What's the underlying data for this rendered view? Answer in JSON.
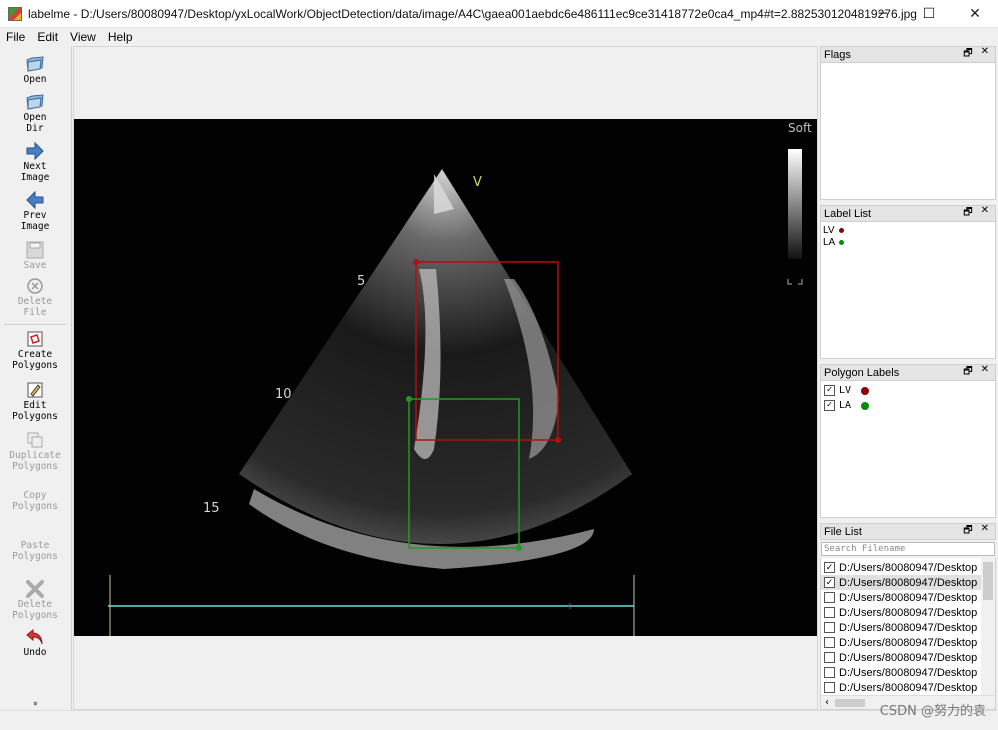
{
  "window": {
    "title": "labelme - D:/Users/80080947/Desktop/yxLocalWork/ObjectDetection/data/image/A4C\\gaea001aebdc6e486111ec9ce31418772e0ca4_mp4#t=2.8825301204819276.jpg",
    "minimize": "─",
    "maximize": "☐",
    "close": "✕"
  },
  "menu": [
    "File",
    "Edit",
    "View",
    "Help"
  ],
  "toolbar": {
    "open": "Open",
    "open_dir": "Open\nDir",
    "next_image": "Next\nImage",
    "prev_image": "Prev\nImage",
    "save": "Save",
    "delete_file": "Delete\nFile",
    "create_polygons": "Create\nPolygons",
    "edit_polygons": "Edit\nPolygons",
    "duplicate_polygons": "Duplicate\nPolygons",
    "copy_polygons": "Copy\nPolygons",
    "paste_polygons": "Paste\nPolygons",
    "delete_polygons": "Delete\nPolygons",
    "undo": "Undo",
    "more": "»"
  },
  "image": {
    "soft_label": "Soft",
    "v_label": "V",
    "depth_5": "5",
    "depth_10": "10",
    "depth_15": "15",
    "depth_marks": [
      "5",
      "10",
      "15"
    ]
  },
  "annotations": [
    {
      "label": "LV",
      "color": "#b01010"
    },
    {
      "label": "LA",
      "color": "#1f9a1f"
    }
  ],
  "docks": {
    "flags": {
      "title": "Flags",
      "float_icon": "🗗",
      "close_icon": "✕"
    },
    "label_list": {
      "title": "Label List",
      "items": [
        {
          "label": "LV",
          "color": "#8b0000"
        },
        {
          "label": "LA",
          "color": "#0a8a0a"
        }
      ]
    },
    "polygon_labels": {
      "title": "Polygon Labels",
      "items": [
        {
          "label": "LV",
          "color": "#8b0000",
          "checked": true
        },
        {
          "label": "LA",
          "color": "#0a8a0a",
          "checked": true
        }
      ]
    },
    "file_list": {
      "title": "File List",
      "search_placeholder": "Search Filename",
      "files": [
        {
          "name": "D:/Users/80080947/Desktop",
          "checked": true
        },
        {
          "name": "D:/Users/80080947/Desktop",
          "checked": true,
          "selected": true
        },
        {
          "name": "D:/Users/80080947/Desktop",
          "checked": false
        },
        {
          "name": "D:/Users/80080947/Desktop",
          "checked": false
        },
        {
          "name": "D:/Users/80080947/Desktop",
          "checked": false
        },
        {
          "name": "D:/Users/80080947/Desktop",
          "checked": false
        },
        {
          "name": "D:/Users/80080947/Desktop",
          "checked": false
        },
        {
          "name": "D:/Users/80080947/Desktop",
          "checked": false
        },
        {
          "name": "D:/Users/80080947/Desktop",
          "checked": false
        }
      ]
    }
  },
  "watermark": "CSDN @努力的袁"
}
